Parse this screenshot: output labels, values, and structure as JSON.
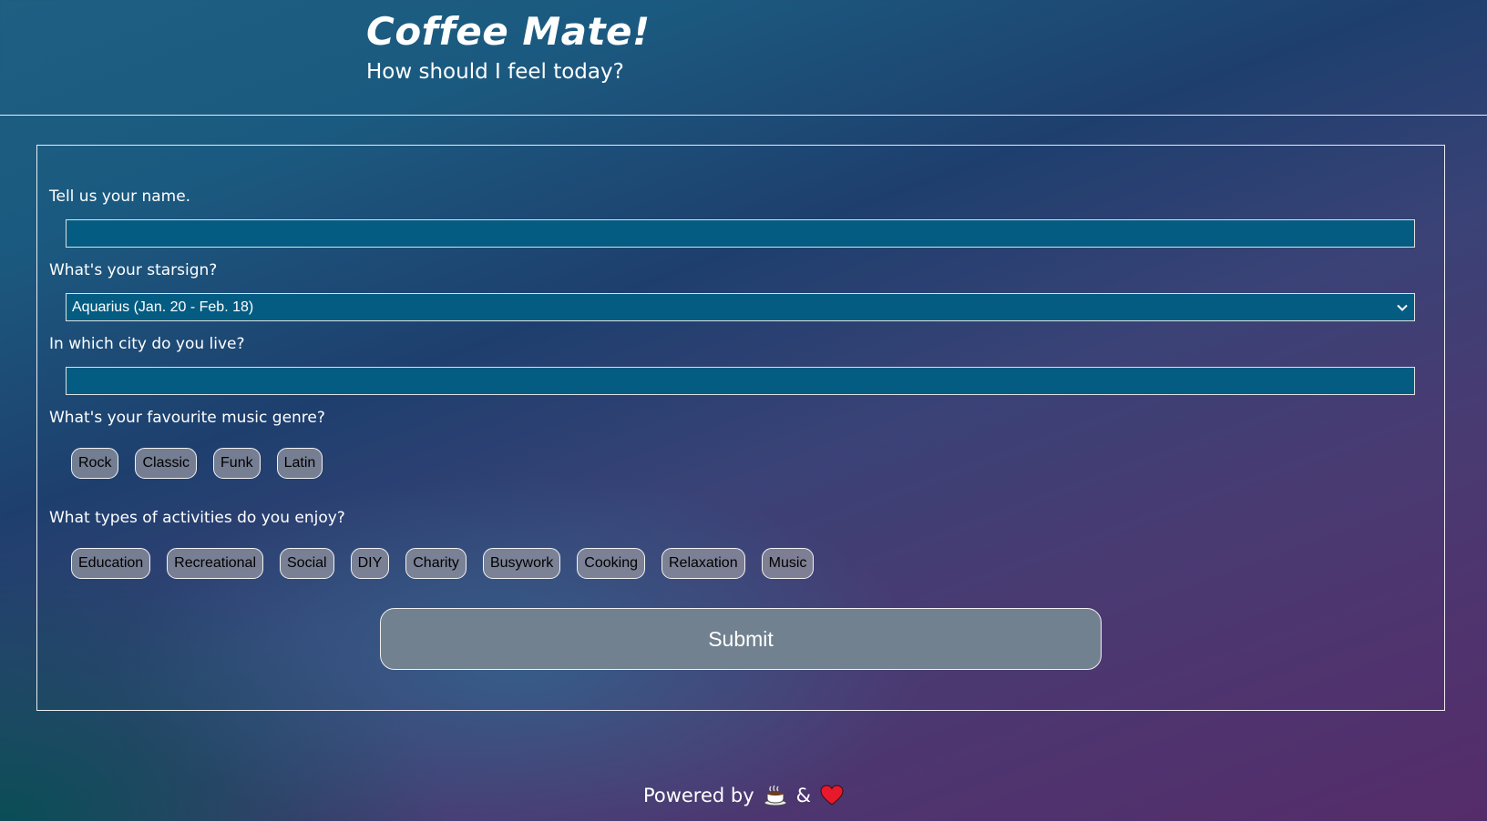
{
  "header": {
    "title": "Coffee Mate!",
    "subtitle": "How should I feel today?"
  },
  "form": {
    "name_label": "Tell us your name.",
    "name_value": "",
    "starsign_label": "What's your starsign?",
    "starsign_selected": "Aquarius (Jan. 20 - Feb. 18)",
    "city_label": "In which city do you live?",
    "city_value": "",
    "music_label": "What's your favourite music genre?",
    "music_genres": [
      "Rock",
      "Classic",
      "Funk",
      "Latin"
    ],
    "activities_label": "What types of activities do you enjoy?",
    "activities": [
      "Education",
      "Recreational",
      "Social",
      "DIY",
      "Charity",
      "Busywork",
      "Cooking",
      "Relaxation",
      "Music"
    ],
    "submit_label": "Submit"
  },
  "footer": {
    "powered_by": "Powered by",
    "ampersand": "&",
    "icons": [
      "coffee-icon",
      "heart-icon"
    ]
  },
  "colors": {
    "input_bg": "#045c82",
    "chip_bg": "#96969f",
    "submit_bg": "#71818f",
    "heart": "#e8192c"
  }
}
